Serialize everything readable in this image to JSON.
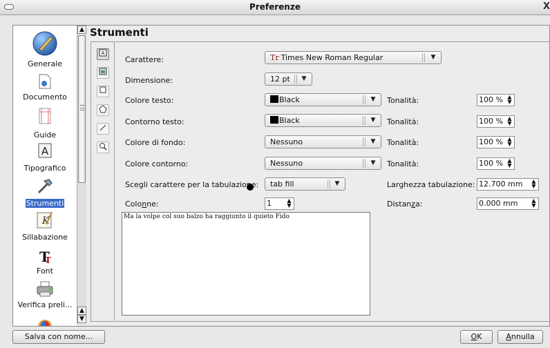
{
  "window": {
    "title": "Preferenze",
    "close_glyph": "X"
  },
  "sidebar": {
    "items": [
      {
        "label": "Generale",
        "icon": "globe-pen-icon"
      },
      {
        "label": "Documento",
        "icon": "document-icon"
      },
      {
        "label": "Guide",
        "icon": "guides-icon"
      },
      {
        "label": "Tipografico",
        "icon": "typography-icon"
      },
      {
        "label": "Strumenti",
        "icon": "hammer-icon",
        "selected": true
      },
      {
        "label": "Sillabazione",
        "icon": "hyphenation-icon"
      },
      {
        "label": "Font",
        "icon": "font-icon"
      },
      {
        "label": "Verifica preli...",
        "icon": "printer-icon"
      }
    ]
  },
  "section": {
    "title": "Strumenti"
  },
  "tools": [
    "text-frame-tool-icon",
    "image-frame-tool-icon",
    "shape-tool-icon",
    "polygon-tool-icon",
    "line-tool-icon",
    "zoom-tool-icon"
  ],
  "form": {
    "carattere": {
      "label": "Carattere:",
      "value": "Times New Roman Regular",
      "icon_glyph": "Tr"
    },
    "dimensione": {
      "label": "Dimensione:",
      "value": "12 pt"
    },
    "colore_testo": {
      "label": "Colore testo:",
      "value": "Black",
      "tonalita_label": "Tonalità:",
      "tonalita_value": "100 %"
    },
    "contorno_testo": {
      "label": "Contorno testo:",
      "value": "Black",
      "tonalita_label": "Tonalità:",
      "tonalita_value": "100 %"
    },
    "colore_fondo": {
      "label": "Colore di fondo:",
      "value": "Nessuno",
      "tonalita_label": "Tonalità:",
      "tonalita_value": "100 %"
    },
    "colore_contorno": {
      "label": "Colore contorno:",
      "value": "Nessuno",
      "tonalita_label": "Tonalità:",
      "tonalita_value": "100 %"
    },
    "tab_fill": {
      "label": "Scegli carattere per la tabulazione:",
      "value": "tab fill"
    },
    "larghezza_tab": {
      "label": "Larghezza tabulazione:",
      "value": "12.700 mm"
    },
    "colonne": {
      "label_pre": "Colo",
      "label_mn": "n",
      "label_post": "ne:",
      "value": "1"
    },
    "distanza": {
      "label_pre": "Distan",
      "label_mn": "z",
      "label_post": "a:",
      "value": "0.000 mm"
    },
    "preview_text": "Ma la volpe col suo balzo ha raggiunto il quieto Fido"
  },
  "buttons": {
    "save_as": "Salva con nome...",
    "ok_mn": "O",
    "ok_rest": "K",
    "cancel_mn": "A",
    "cancel_rest": "nnulla"
  },
  "colors": {
    "selection": "#3a6bc6",
    "swatch_black": "#000000"
  }
}
